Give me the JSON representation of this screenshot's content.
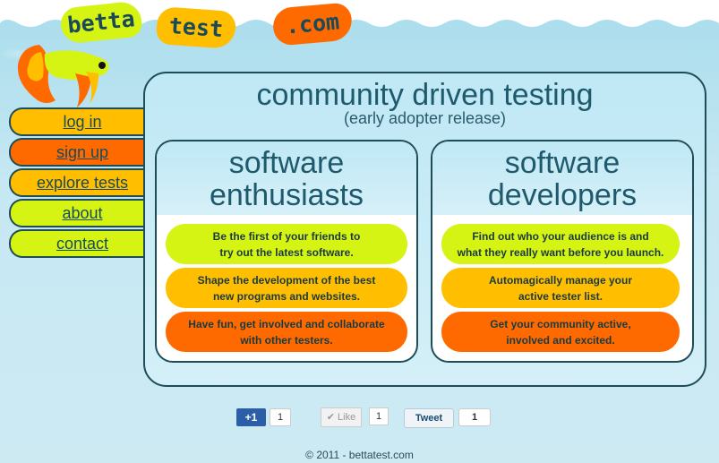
{
  "logo": {
    "part1": "betta",
    "part2": "test",
    "part3": ".com"
  },
  "nav": {
    "items": [
      {
        "label": "log in",
        "color": "#ffbf00"
      },
      {
        "label": "sign up",
        "color": "#ff6a00"
      },
      {
        "label": "explore tests",
        "color": "#ffbf00"
      },
      {
        "label": "about",
        "color": "#d6f414"
      },
      {
        "label": "contact",
        "color": "#d6f414"
      }
    ]
  },
  "main": {
    "title": "community driven testing",
    "subtitle": "(early adopter release)",
    "enthusiasts": {
      "title_line1": "software",
      "title_line2": "enthusiasts",
      "points": [
        {
          "line1": "Be the first of your friends to",
          "line2": "try out the latest software."
        },
        {
          "line1": "Shape the development of the best",
          "line2": "new programs and websites."
        },
        {
          "line1": "Have fun, get involved and collaborate",
          "line2": "with other testers."
        }
      ]
    },
    "developers": {
      "title_line1": "software",
      "title_line2": "developers",
      "points": [
        {
          "line1": "Find out who your audience is and",
          "line2": "what they really want before you launch."
        },
        {
          "line1": "Automagically manage your",
          "line2": "active tester list."
        },
        {
          "line1": "Get your community active,",
          "line2": "involved and excited."
        }
      ]
    }
  },
  "social": {
    "gplus_label": "+1",
    "gplus_count": "1",
    "like_label": "✔ Like",
    "like_count": "1",
    "tweet_label": "Tweet",
    "tweet_count": "1"
  },
  "footer": {
    "text": "© 2011 - bettatest.com"
  },
  "colors": {
    "green": "#d6f414",
    "yellow": "#ffbf00",
    "orange": "#ff6a00",
    "dark": "#1f4d57"
  }
}
